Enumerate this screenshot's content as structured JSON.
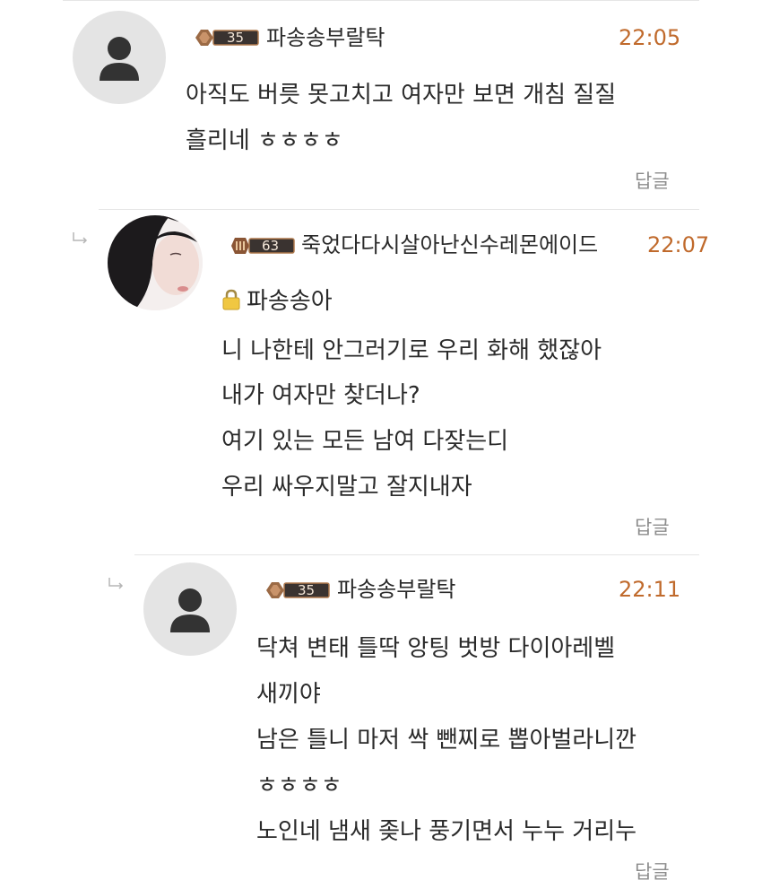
{
  "comments": [
    {
      "level": 35,
      "nickname": "파송송부랄탁",
      "time": "22:05",
      "lines": [
        "아직도 버릇 못고치고 여자만 보면 개침 질질",
        "흘리네 ㅎㅎㅎㅎ"
      ],
      "reply_label": "답글",
      "avatar": "default-user-icon"
    },
    {
      "level": 63,
      "nickname": "죽었다다시살아난신수레몬에이드",
      "time": "22:07",
      "mention": "파송송아",
      "lines": [
        "니 나한테  안그러기로 우리 화해 했잖아",
        "내가 여자만 찾더나?",
        "여기 있는 모든 남여 다잦는디",
        "우리 싸우지말고 잘지내자"
      ],
      "reply_label": "답글",
      "avatar": "profile-photo"
    },
    {
      "level": 35,
      "nickname": "파송송부랄탁",
      "time": "22:11",
      "lines": [
        "닥쳐 변태 틀딱 앙팅 벗방 다이아레벨",
        "새끼야",
        "남은 틀니 마저 싹 뺀찌로 뽑아벌라니깐",
        "ㅎㅎㅎㅎ",
        "노인네 냄새 좆나 풍기면서 누누 거리누"
      ],
      "reply_label": "답글",
      "avatar": "default-user-icon"
    }
  ],
  "colors": {
    "time": "#c06a2c",
    "text": "#2a2a2a",
    "reply": "#8d8d8d",
    "badge_dark": "#3a3330",
    "badge_gold": "#b07a4e"
  }
}
